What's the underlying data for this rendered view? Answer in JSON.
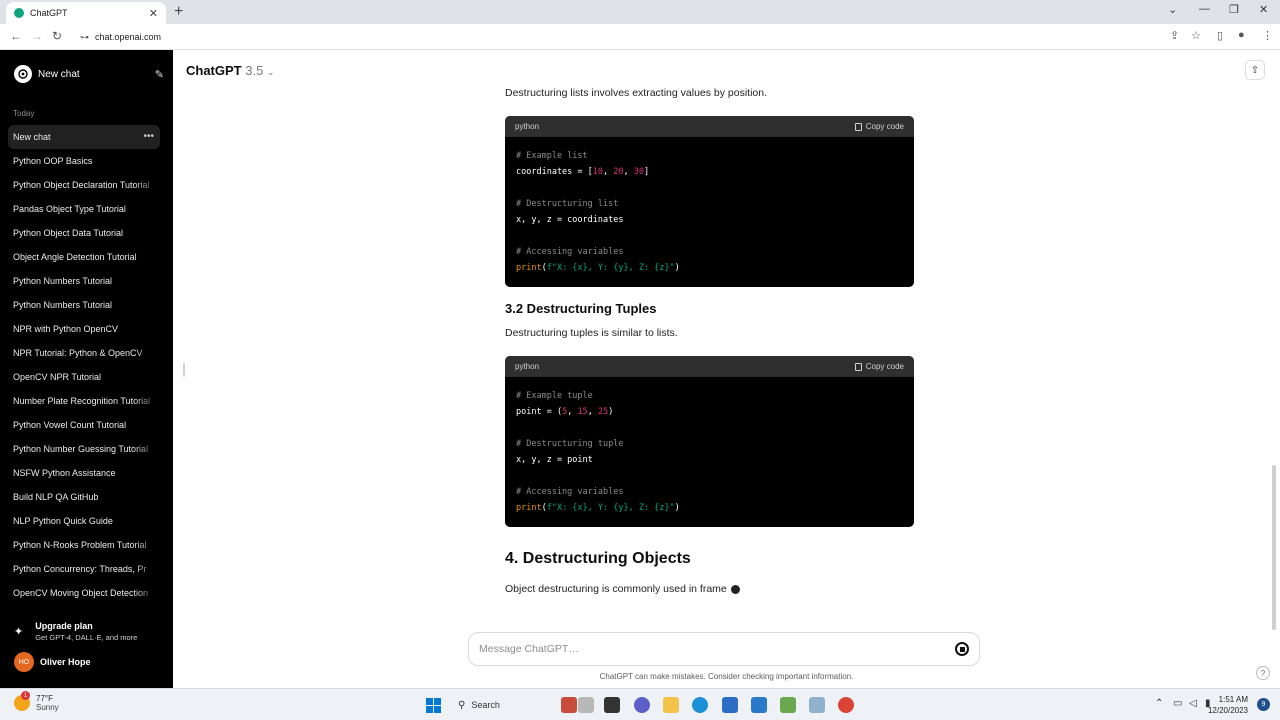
{
  "browser": {
    "tab_title": "ChatGPT",
    "url": "chat.openai.com"
  },
  "sidebar": {
    "new_chat": "New chat",
    "section": "Today",
    "active_item": "New chat",
    "items": [
      "Python OOP Basics",
      "Python Object Declaration Tutorial",
      "Pandas Object Type Tutorial",
      "Python Object Data Tutorial",
      "Object Angle Detection Tutorial",
      "Python Numbers Tutorial",
      "Python Numbers Tutorial",
      "NPR with Python OpenCV",
      "NPR Tutorial: Python & OpenCV",
      "OpenCV NPR Tutorial",
      "Number Plate Recognition Tutorial",
      "Python Vowel Count Tutorial",
      "Python Number Guessing Tutorial",
      "NSFW Python Assistance",
      "Build NLP QA GitHub",
      "NLP Python Quick Guide",
      "Python N-Rooks Problem Tutorial",
      "Python Concurrency: Threads, Pr",
      "OpenCV Moving Object Detection"
    ],
    "upgrade_title": "Upgrade plan",
    "upgrade_sub": "Get GPT-4, DALL·E, and more",
    "user_initials": "HO",
    "user_name": "Oliver Hope"
  },
  "header": {
    "model_name": "ChatGPT",
    "model_version": "3.5"
  },
  "content": {
    "intro_text": "Destructuring lists involves extracting values by position.",
    "code_lang": "python",
    "copy_label": "Copy code",
    "section_32_title": "3.2 Destructuring Tuples",
    "section_32_text": "Destructuring tuples is similar to lists.",
    "section_4_title": "4. Destructuring Objects",
    "section_4_text": "Object destructuring is commonly used in frame",
    "code1": {
      "c1": "# Example list",
      "l1_pre": "coordinates = [",
      "n1": "10",
      "n2": "20",
      "n3": "30",
      "l1_post": "]",
      "c2": "# Destructuring list",
      "l2": "x, y, z = coordinates",
      "c3": "# Accessing variables",
      "fn": "print",
      "paren_open": "(",
      "str": "f\"X: {x}, Y: {y}, Z: {z}\"",
      "paren_close": ")"
    },
    "code2": {
      "c1": "# Example tuple",
      "l1_pre": "point = (",
      "n1": "5",
      "n2": "15",
      "n3": "25",
      "l1_post": ")",
      "c2": "# Destructuring tuple",
      "l2": "x, y, z = point",
      "c3": "# Accessing variables",
      "fn": "print",
      "paren_open": "(",
      "str": "f\"X: {x}, Y: {y}, Z: {z}\"",
      "paren_close": ")"
    }
  },
  "composer": {
    "placeholder": "Message ChatGPT…",
    "disclaimer": "ChatGPT can make mistakes. Consider checking important information.",
    "help": "?"
  },
  "taskbar": {
    "temp": "77°F",
    "condition": "Sunny",
    "weather_badge": "1",
    "search": "Search",
    "time": "1:51 AM",
    "date": "12/20/2023",
    "notifications": "9"
  },
  "colors": {
    "sidebar_bg": "#000000",
    "code_header": "#2f2f2f",
    "keyword_num": "#df3079",
    "keyword_fn": "#e9950c",
    "keyword_str": "#00a67d",
    "comment": "#8b8b8b",
    "avatar": "#e5661f"
  }
}
